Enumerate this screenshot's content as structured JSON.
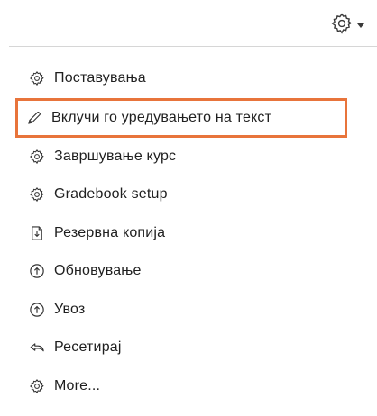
{
  "menu": {
    "items": [
      {
        "label": "Поставувања",
        "icon": "gear-icon"
      },
      {
        "label": "Вклучи го уредувањето на текст",
        "icon": "pencil-icon",
        "highlighted": true
      },
      {
        "label": "Завршување курс",
        "icon": "gear-icon"
      },
      {
        "label": "Gradebook setup",
        "icon": "gear-icon"
      },
      {
        "label": "Резервна копија",
        "icon": "file-download-icon"
      },
      {
        "label": "Обновување",
        "icon": "upload-circle-icon"
      },
      {
        "label": "Увоз",
        "icon": "upload-circle-icon"
      },
      {
        "label": "Ресетирај",
        "icon": "reset-arrow-icon"
      },
      {
        "label": "More...",
        "icon": "gear-icon"
      }
    ]
  },
  "colors": {
    "highlight_border": "#e8743b",
    "text": "#1f1f1f",
    "divider": "#d6d6d6"
  }
}
